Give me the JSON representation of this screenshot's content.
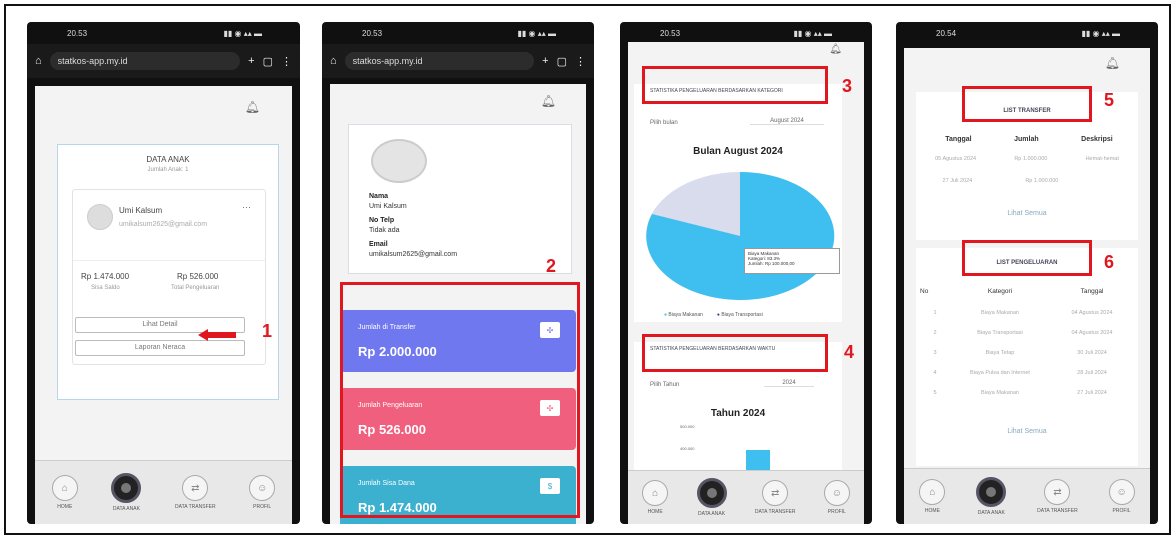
{
  "status": {
    "p1": "20.53",
    "p2": "20.53",
    "p3": "20.53",
    "p4": "20.54"
  },
  "urlbar": {
    "url": "statkos-app.my.id"
  },
  "screen1": {
    "card_title": "DATA ANAK",
    "card_sub": "Jumlah Anak: 1",
    "name": "Umi Kalsum",
    "email": "umikalsum2625@gmail.com",
    "saldo_value": "Rp 1.474.000",
    "saldo_label": "Sisa Saldo",
    "pengeluaran_value": "Rp 526.000",
    "pengeluaran_label": "Total Pengeluaran",
    "detail_button": "Lihat Detail",
    "neraca_button": "Laporan Neraca",
    "marker": "1"
  },
  "screen2": {
    "nama_label": "Nama",
    "nama_value": "Umi Kalsum",
    "telp_label": "No Telp",
    "telp_value": "Tidak ada",
    "email_label": "Email",
    "email_value": "umikalsum2625@gmail.com",
    "transfer_label": "Jumlah di Transfer",
    "transfer_value": "Rp 2.000.000",
    "pengeluaran_label": "Jumlah Pengeluaran",
    "pengeluaran_value": "Rp 526.000",
    "sisa_label": "Jumlah Sisa Dana",
    "sisa_value": "Rp 1.474.000",
    "marker": "2"
  },
  "screen3": {
    "kategori_title": "STATISTIKA PENGELUARAN BERDASARKAN KATEGORI",
    "bulan_label": "Pilih bulan",
    "bulan_value": "August 2024",
    "chart_title": "Bulan August 2024",
    "tooltip_title": "Biaya Makanan",
    "tooltip_kategori": "Kategori: 83.3%",
    "tooltip_jumlah": "Jumlah: Rp 100.000,00",
    "legend_1": "Biaya Makanan",
    "legend_2": "Biaya Transportasi",
    "waktu_title": "STATISTIKA PENGELUARAN BERDASARKAN WAKTU",
    "tahun_label": "Pilih Tahun",
    "tahun_value": "2024",
    "chart2_title": "Tahun 2024",
    "tick_1": "500.000",
    "tick_2": "400.000",
    "marker_3": "3",
    "marker_4": "4"
  },
  "screen4": {
    "transfer_title": "LIST TRANSFER",
    "col_tanggal": "Tanggal",
    "col_jumlah": "Jumlah",
    "col_deskripsi": "Deskripsi",
    "transfers": [
      {
        "tanggal": "05 Agustus 2024",
        "jumlah": "Rp 1.000.000",
        "deskripsi": "Hemat-hemat"
      },
      {
        "tanggal": "27 Juli 2024",
        "jumlah": "Rp 1.000.000",
        "deskripsi": ""
      }
    ],
    "lihat_semua_1": "Lihat Semua",
    "pengeluaran_title": "LIST PENGELUARAN",
    "col_no": "No",
    "col_kategori": "Kategori",
    "col_tanggal2": "Tanggal",
    "pengeluaran": [
      {
        "no": "1",
        "kategori": "Biaya Makanan",
        "tanggal": "04 Agustus 2024"
      },
      {
        "no": "2",
        "kategori": "Biaya Transportasi",
        "tanggal": "04 Agustus 2024"
      },
      {
        "no": "3",
        "kategori": "Biaya Tetap",
        "tanggal": "30 Juli 2024"
      },
      {
        "no": "4",
        "kategori": "Biaya Pulsa dan Internet",
        "tanggal": "28 Juli 2024"
      },
      {
        "no": "5",
        "kategori": "Biaya Makanan",
        "tanggal": "27 Juli 2024"
      }
    ],
    "lihat_semua_2": "Lihat Semua",
    "marker_5": "5",
    "marker_6": "6"
  },
  "nav": {
    "home": "HOME",
    "data_anak": "DATA ANAK",
    "data_transfer": "DATA TRANSFER",
    "profil": "PROFIL"
  },
  "colors": {
    "accent_red": "#e0171e",
    "transfer_card": "#7078f0",
    "pengeluaran_card": "#f0607e",
    "sisa_card": "#3bb0cf",
    "pie_main": "#3fbff0",
    "pie_minor": "#d9dcec"
  },
  "icons": {
    "bell": "bell-icon",
    "home": "home-icon",
    "user": "user-icon",
    "transfer": "transfer-icon",
    "profile": "profile-icon",
    "tabs": "tabs-icon",
    "menu": "menu-icon"
  }
}
